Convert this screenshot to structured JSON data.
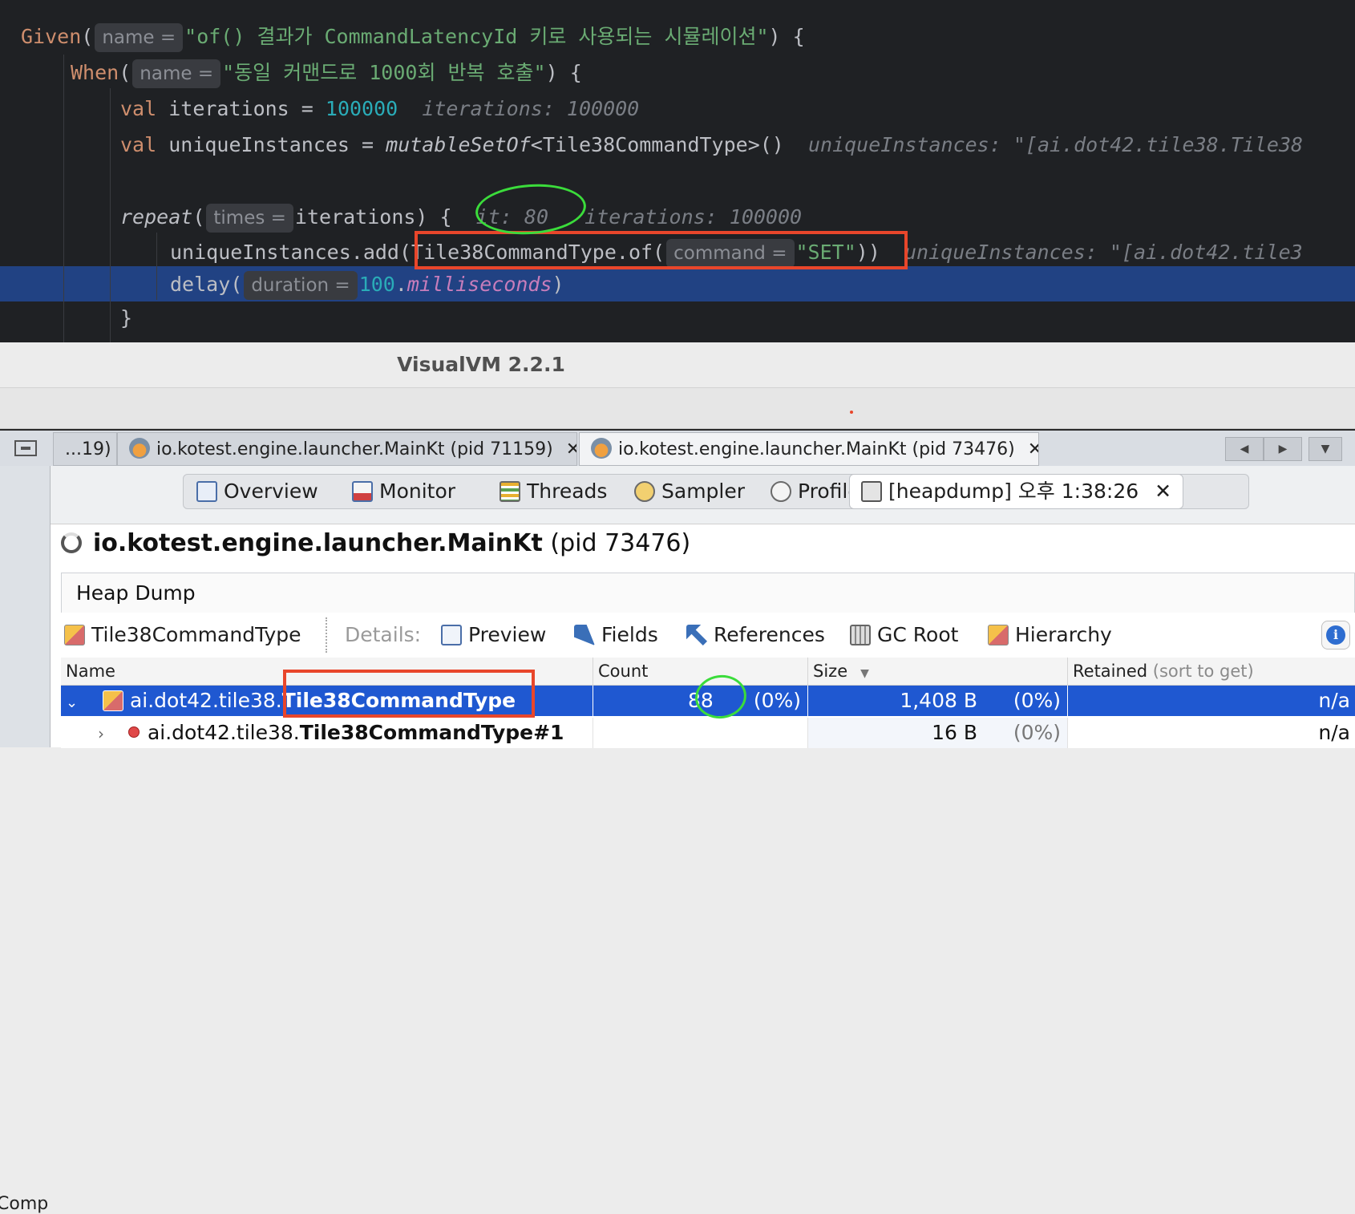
{
  "editor": {
    "given_kw": "Given",
    "given_hint": "name =",
    "given_str": "\"of() 결과가 CommandLatencyId 키로 사용되는 시뮬레이션\"",
    "when_kw": "When",
    "when_hint": "name =",
    "when_str": "\"동일 커맨드로 1000회 반복 호출\"",
    "val_kw": "val",
    "iter_name": "iterations",
    "iter_value": "100000",
    "iter_inline": "iterations: 100000",
    "unique_name": "uniqueInstances",
    "unique_call": "mutableSetOf",
    "unique_type": "<Tile38CommandType>()",
    "unique_inline": "uniqueInstances: \"[ai.dot42.tile38.Tile38",
    "repeat_fn": "repeat",
    "repeat_hint": "times =",
    "repeat_arg": "iterations) {",
    "repeat_it": "it: 80",
    "repeat_inline": "iterations: 100000",
    "add_call": "uniqueInstances.add(",
    "add_of": "Tile38CommandType.of(",
    "add_hint": "command =",
    "add_str": "\"SET\"",
    "add_close": "))",
    "add_inline": "uniqueInstances: \"[ai.dot42.tile3",
    "delay_fn": "delay(",
    "delay_hint": "duration =",
    "delay_num": "100",
    "delay_prop": "milliseconds",
    "close_brace": "}"
  },
  "visualvm": {
    "window_title": "VisualVM 2.2.1",
    "doc_tabs": [
      {
        "label": "...19)"
      },
      {
        "label": "io.kotest.engine.launcher.MainKt (pid 71159)",
        "close": "✕"
      },
      {
        "label": "io.kotest.engine.launcher.MainKt (pid 73476)",
        "close": "✕"
      }
    ],
    "nav": {
      "prev": "◀",
      "next": "▶",
      "menu": "▼"
    },
    "view_tabs": {
      "overview": "Overview",
      "monitor": "Monitor",
      "threads": "Threads",
      "sampler": "Sampler",
      "profiler": "Profiler",
      "heapdump": "[heapdump] 오후 1:38:26",
      "heapdump_close": "✕"
    },
    "process_name": "io.kotest.engine.launcher.MainKt",
    "process_pid": "(pid 73476)",
    "heap_label": "Heap Dump",
    "class_name": "Tile38CommandType",
    "details_label": "Details:",
    "details_buttons": {
      "preview": "Preview",
      "fields": "Fields",
      "references": "References",
      "gc_root": "GC Root",
      "hierarchy": "Hierarchy"
    },
    "table": {
      "headers": {
        "name": "Name",
        "count": "Count",
        "size": "Size",
        "retained": "Retained",
        "retained_hint": "(sort to get)"
      },
      "rows": [
        {
          "pkg": "ai.dot42.tile38.",
          "cls": "Tile38CommandType",
          "count": "88",
          "count_pct": "(0%)",
          "size": "1,408 B",
          "size_pct": "(0%)",
          "retained": "n/a"
        },
        {
          "pkg": "ai.dot42.tile38.",
          "cls": "Tile38CommandType#1",
          "count": "",
          "count_pct": "",
          "size": "16 B",
          "size_pct": "(0%)",
          "retained": "n/a"
        }
      ]
    },
    "left_partial": "Comp"
  },
  "colors": {
    "editor_bg": "#1f2124",
    "highlight_line": "#214283",
    "annotation_red": "#e8462b",
    "annotation_green": "#3bdc3b",
    "selected_row": "#1f58d1"
  }
}
